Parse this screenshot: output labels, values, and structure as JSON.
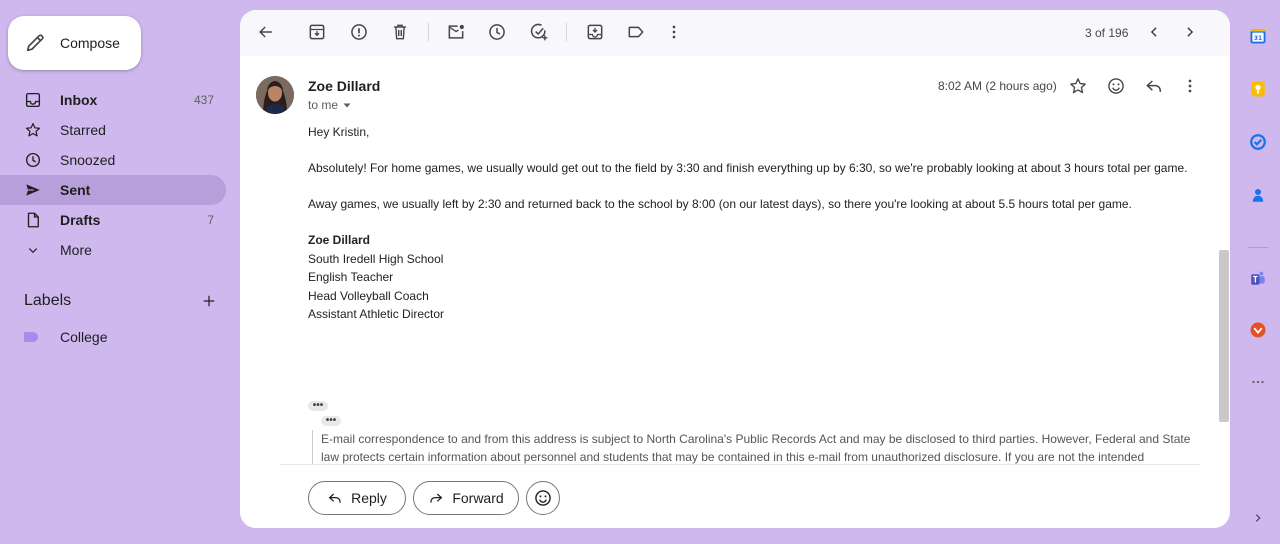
{
  "compose": {
    "label": "Compose",
    "icon": "pencil-icon"
  },
  "nav": [
    {
      "label": "Inbox",
      "count": "437",
      "icon": "inbox-icon",
      "bold": true
    },
    {
      "label": "Starred",
      "count": "",
      "icon": "star-icon"
    },
    {
      "label": "Snoozed",
      "count": "",
      "icon": "clock-icon"
    },
    {
      "label": "Sent",
      "count": "",
      "icon": "send-icon",
      "bold": true,
      "active": true
    },
    {
      "label": "Drafts",
      "count": "7",
      "icon": "draft-icon",
      "bold": true
    },
    {
      "label": "More",
      "count": "",
      "icon": "chevron-down-icon"
    }
  ],
  "labels": {
    "heading": "Labels",
    "items": [
      {
        "label": "College",
        "color": "#a78be8"
      }
    ]
  },
  "toolbar": {
    "pager": "3 of 196",
    "icons": [
      "back-arrow-icon",
      "archive-icon",
      "report-spam-icon",
      "delete-icon",
      "mark-unread-icon",
      "snooze-icon",
      "add-task-icon",
      "move-to-icon",
      "label-icon",
      "more-vert-icon",
      "older-chevron-icon",
      "newer-chevron-icon"
    ]
  },
  "message": {
    "sender": "Zoe Dillard",
    "to": "to me",
    "time": "8:02 AM (2 hours ago)",
    "greeting": "Hey Kristin,",
    "paragraph1": "Absolutely! For home games, we usually would get out to the field by 3:30 and finish everything up by 6:30, so we're probably looking at about 3 hours total per game.",
    "paragraph2": "Away games, we usually left by 2:30 and returned back to the school by 8:00 (on our latest days), so there you're looking at about 5.5 hours total per game.",
    "signature": {
      "name": "Zoe Dillard",
      "line1": "South Iredell High School",
      "line2": "English Teacher",
      "line3": "Head Volleyball Coach",
      "line4": "Assistant Athletic Director"
    },
    "quoted_text": "E-mail correspondence to and from this address is subject to North Carolina's Public Records Act and may be disclosed to third parties. However, Federal and State law protects certain information about personnel and students that may be contained in this e-mail from unauthorized disclosure. If you are not the intended"
  },
  "actions": {
    "reply": "Reply",
    "forward": "Forward"
  },
  "colors": {
    "background": "#cfb8ee",
    "active_nav": "#b79fdc",
    "panel": "#ffffff"
  },
  "rail_icons": [
    "calendar-icon",
    "keep-icon",
    "tasks-icon",
    "contacts-icon",
    "teams-icon",
    "addon-icon",
    "more-horiz-icon",
    "expand-icon"
  ]
}
